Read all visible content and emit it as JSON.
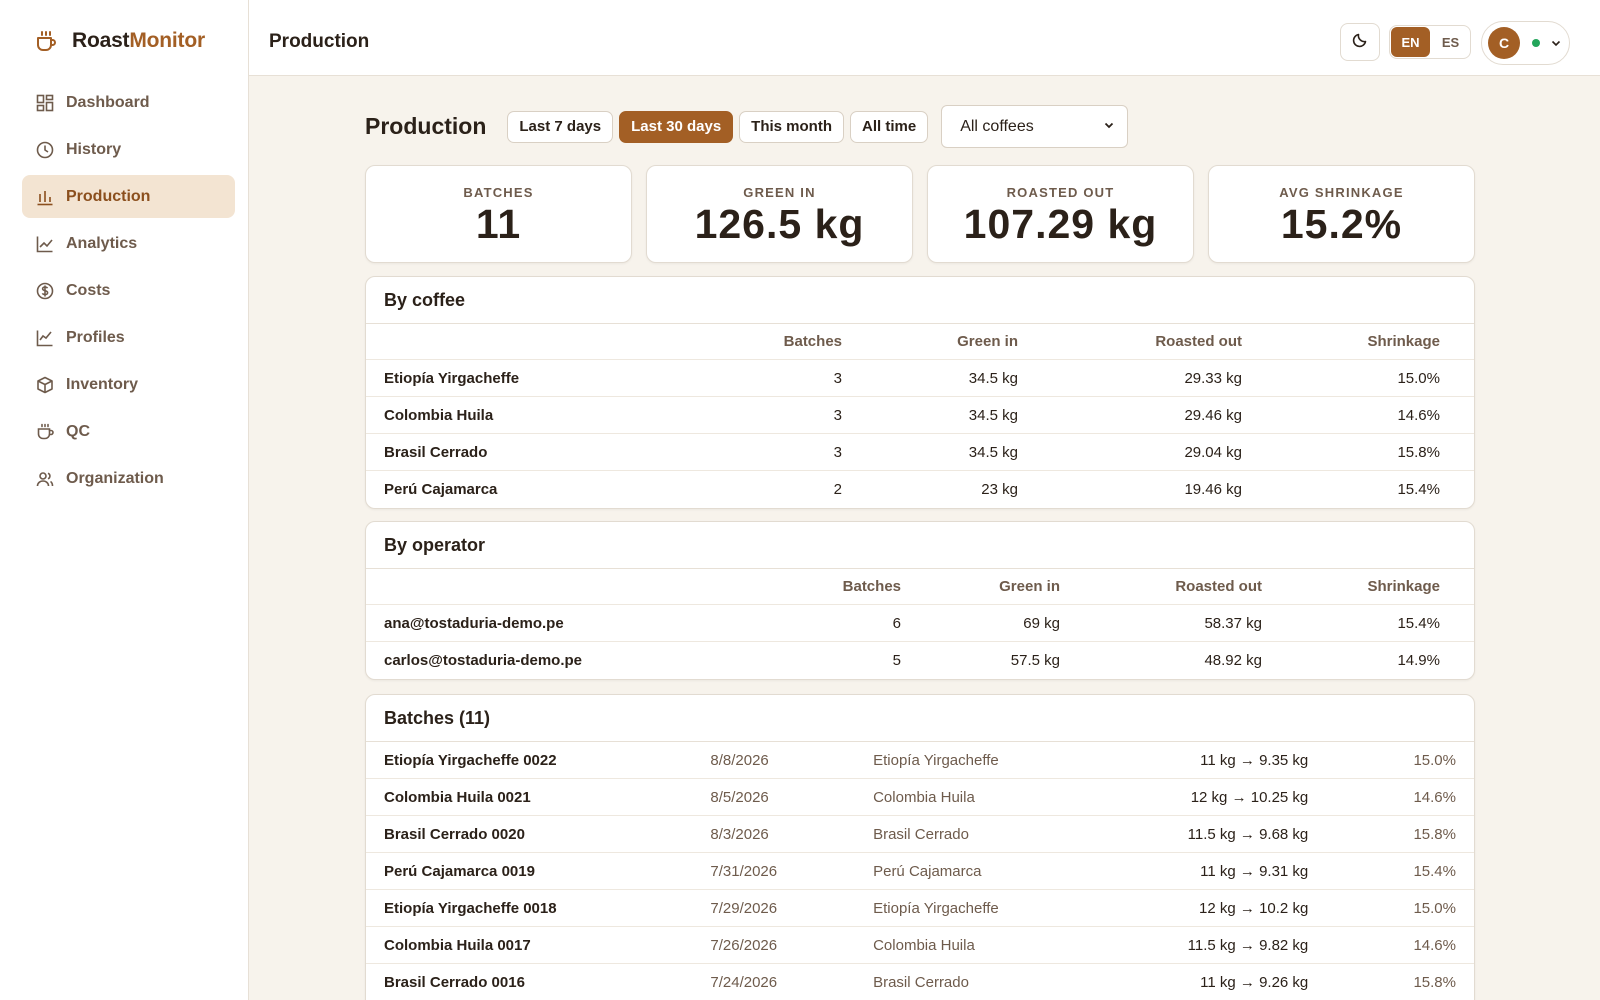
{
  "brand": {
    "part1": "Roast",
    "part2": "Monitor"
  },
  "sidebar": {
    "items": [
      {
        "label": "Dashboard",
        "icon": "dashboard-icon"
      },
      {
        "label": "History",
        "icon": "clock-icon"
      },
      {
        "label": "Production",
        "icon": "bar-chart-icon",
        "active": true
      },
      {
        "label": "Analytics",
        "icon": "line-chart-icon"
      },
      {
        "label": "Costs",
        "icon": "dollar-icon"
      },
      {
        "label": "Profiles",
        "icon": "trend-icon"
      },
      {
        "label": "Inventory",
        "icon": "box-icon"
      },
      {
        "label": "QC",
        "icon": "cup-icon"
      },
      {
        "label": "Organization",
        "icon": "users-icon"
      }
    ]
  },
  "topbar": {
    "title": "Production",
    "lang": {
      "en": "EN",
      "es": "ES",
      "active": "EN"
    },
    "user_initial": "C"
  },
  "main": {
    "title": "Production",
    "ranges": [
      "Last 7 days",
      "Last 30 days",
      "This month",
      "All time"
    ],
    "active_range": "Last 30 days",
    "coffee_filter": "All coffees"
  },
  "stats": [
    {
      "label": "BATCHES",
      "value": "11"
    },
    {
      "label": "GREEN IN",
      "value": "126.5 kg"
    },
    {
      "label": "ROASTED OUT",
      "value": "107.29 kg"
    },
    {
      "label": "AVG SHRINKAGE",
      "value": "15.2%"
    }
  ],
  "by_coffee": {
    "title": "By coffee",
    "headers": [
      "Batches",
      "Green in",
      "Roasted out",
      "Shrinkage"
    ],
    "rows": [
      [
        "Etiopía Yirgacheffe",
        "3",
        "34.5 kg",
        "29.33 kg",
        "15.0%"
      ],
      [
        "Colombia Huila",
        "3",
        "34.5 kg",
        "29.46 kg",
        "14.6%"
      ],
      [
        "Brasil Cerrado",
        "3",
        "34.5 kg",
        "29.04 kg",
        "15.8%"
      ],
      [
        "Perú Cajamarca",
        "2",
        "23 kg",
        "19.46 kg",
        "15.4%"
      ]
    ]
  },
  "by_operator": {
    "title": "By operator",
    "headers": [
      "Batches",
      "Green in",
      "Roasted out",
      "Shrinkage"
    ],
    "rows": [
      [
        "ana@tostaduria-demo.pe",
        "6",
        "69 kg",
        "58.37 kg",
        "15.4%"
      ],
      [
        "carlos@tostaduria-demo.pe",
        "5",
        "57.5 kg",
        "48.92 kg",
        "14.9%"
      ]
    ]
  },
  "batches": {
    "title": "Batches (11)",
    "rows": [
      [
        "Etiopía Yirgacheffe 0022",
        "8/8/2026",
        "Etiopía Yirgacheffe",
        "11 kg → 9.35 kg",
        "15.0%"
      ],
      [
        "Colombia Huila 0021",
        "8/5/2026",
        "Colombia Huila",
        "12 kg → 10.25 kg",
        "14.6%"
      ],
      [
        "Brasil Cerrado 0020",
        "8/3/2026",
        "Brasil Cerrado",
        "11.5 kg → 9.68 kg",
        "15.8%"
      ],
      [
        "Perú Cajamarca 0019",
        "7/31/2026",
        "Perú Cajamarca",
        "11 kg → 9.31 kg",
        "15.4%"
      ],
      [
        "Etiopía Yirgacheffe 0018",
        "7/29/2026",
        "Etiopía Yirgacheffe",
        "12 kg → 10.2 kg",
        "15.0%"
      ],
      [
        "Colombia Huila 0017",
        "7/26/2026",
        "Colombia Huila",
        "11.5 kg → 9.82 kg",
        "14.6%"
      ],
      [
        "Brasil Cerrado 0016",
        "7/24/2026",
        "Brasil Cerrado",
        "11 kg → 9.26 kg",
        "15.8%"
      ]
    ]
  },
  "colors": {
    "accent": "#a35f25",
    "active_bg": "#f3e4d2",
    "bg": "#f7f3ec",
    "online": "#22a55a"
  }
}
